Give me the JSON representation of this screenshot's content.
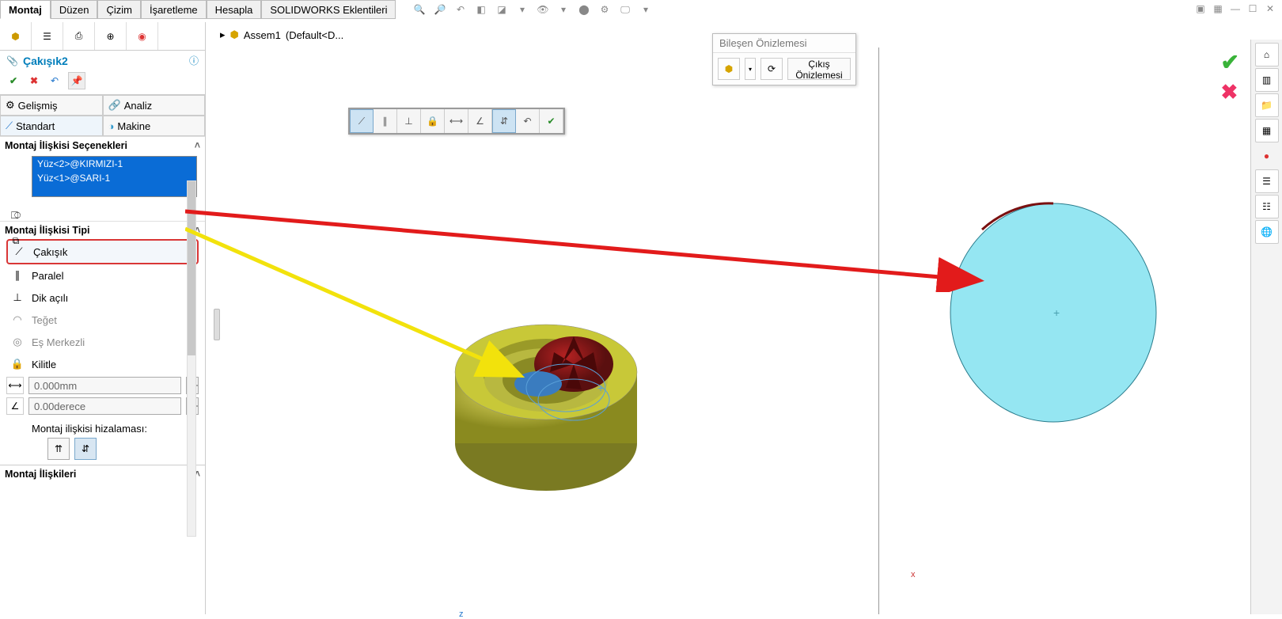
{
  "tabs": [
    "Montaj",
    "Düzen",
    "Çizim",
    "İşaretleme",
    "Hesapla",
    "SOLIDWORKS Eklentileri"
  ],
  "active_tab": 0,
  "breadcrumb": {
    "doc": "Assem1",
    "state": "(Default<D..."
  },
  "property": {
    "title": "Çakışık2",
    "subtabs": {
      "a": "Gelişmiş",
      "b": "Analiz",
      "c": "Standart",
      "d": "Makine"
    },
    "group1": "Montaj İlişkisi Seçenekleri",
    "selections": [
      "Yüz<2>@KIRMIZI-1",
      "Yüz<1>@SARI-1"
    ],
    "group2": "Montaj İlişkisi Tipi",
    "mates": {
      "coincident": "Çakışık",
      "parallel": "Paralel",
      "perpendicular": "Dik açılı",
      "tangent": "Teğet",
      "concentric": "Eş Merkezli",
      "lock": "Kilitle"
    },
    "distance": "0.000mm",
    "angle": "0.00derece",
    "align_label": "Montaj ilişkisi hizalaması:",
    "group3": "Montaj İlişkileri"
  },
  "preview": {
    "title": "Bileşen Önizlemesi",
    "exit": "Çıkış Önizlemesi"
  }
}
